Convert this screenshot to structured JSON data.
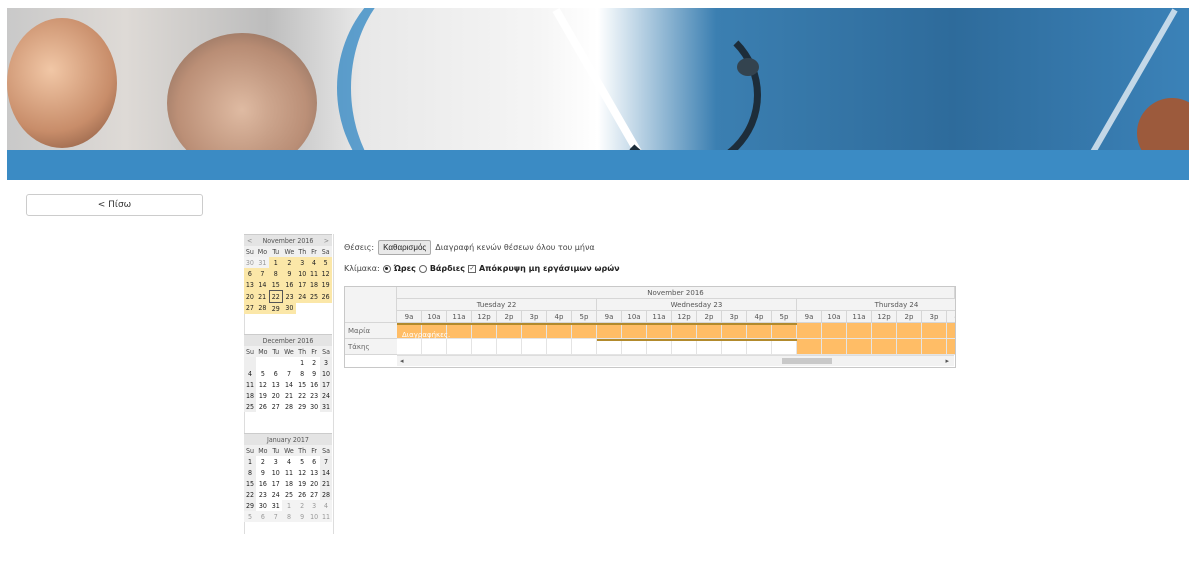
{
  "back_button": "< Πίσω",
  "calendars": [
    {
      "title": "November 2016",
      "prev": "<",
      "next": ">",
      "days": [
        "Su",
        "Mo",
        "Tu",
        "We",
        "Th",
        "Fr",
        "Sa"
      ],
      "weeks": [
        [
          "30",
          "31",
          "1",
          "2",
          "3",
          "4",
          "5"
        ],
        [
          "6",
          "7",
          "8",
          "9",
          "10",
          "11",
          "12"
        ],
        [
          "13",
          "14",
          "15",
          "16",
          "17",
          "18",
          "19"
        ],
        [
          "20",
          "21",
          "22",
          "23",
          "24",
          "25",
          "26"
        ],
        [
          "27",
          "28",
          "29",
          "30",
          "",
          "",
          ""
        ]
      ]
    },
    {
      "title": "December 2016",
      "prev": "",
      "next": "",
      "days": [
        "Su",
        "Mo",
        "Tu",
        "We",
        "Th",
        "Fr",
        "Sa"
      ],
      "weeks": [
        [
          "",
          "",
          "",
          "",
          "1",
          "2",
          "3"
        ],
        [
          "4",
          "5",
          "6",
          "7",
          "8",
          "9",
          "10"
        ],
        [
          "11",
          "12",
          "13",
          "14",
          "15",
          "16",
          "17"
        ],
        [
          "18",
          "19",
          "20",
          "21",
          "22",
          "23",
          "24"
        ],
        [
          "25",
          "26",
          "27",
          "28",
          "29",
          "30",
          "31"
        ]
      ]
    },
    {
      "title": "January 2017",
      "prev": "",
      "next": "",
      "days": [
        "Su",
        "Mo",
        "Tu",
        "We",
        "Th",
        "Fr",
        "Sa"
      ],
      "weeks": [
        [
          "1",
          "2",
          "3",
          "4",
          "5",
          "6",
          "7"
        ],
        [
          "8",
          "9",
          "10",
          "11",
          "12",
          "13",
          "14"
        ],
        [
          "15",
          "16",
          "17",
          "18",
          "19",
          "20",
          "21"
        ],
        [
          "22",
          "23",
          "24",
          "25",
          "26",
          "27",
          "28"
        ],
        [
          "29",
          "30",
          "31",
          "1",
          "2",
          "3",
          "4"
        ],
        [
          "5",
          "6",
          "7",
          "8",
          "9",
          "10",
          "11"
        ]
      ]
    }
  ],
  "positions": {
    "label": "Θέσεις:",
    "clear_button": "Καθαρισμός",
    "description": "Διαγραφή κενών θέσεων όλου του μήνα"
  },
  "scale": {
    "label": "Κλίμακα:",
    "hours": "Ώρες",
    "shifts": "Βάρδιες",
    "hide_label": "Απόκρυψη μη εργάσιμων ωρών",
    "hours_selected": true,
    "hide_checked": true
  },
  "scheduler": {
    "month": "November 2016",
    "days": [
      "Tuesday 22",
      "Wednesday 23",
      "Thursday 24"
    ],
    "hours": [
      "9a",
      "10a",
      "11a",
      "12p",
      "2p",
      "3p",
      "4p",
      "5p"
    ],
    "resources": [
      "Μαρία",
      "Τάκης"
    ],
    "event_label": "Διαγραφήκες.",
    "colors": {
      "event": "#ffbd66",
      "bar": "#b28a2c"
    }
  },
  "scroll": {
    "left": "◂",
    "right": "▸"
  }
}
